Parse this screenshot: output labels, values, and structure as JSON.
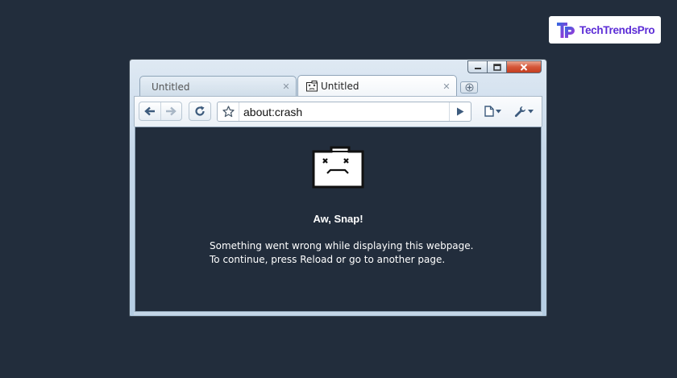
{
  "watermark": {
    "brand_text": "TechTrendsPro",
    "brand_color": "#5b2bd6"
  },
  "window": {
    "caption_buttons": {
      "minimize_icon": "minimize-icon",
      "maximize_icon": "maximize-icon",
      "close_icon": "close-icon",
      "close_color": "#c33d1f"
    },
    "tabs": [
      {
        "label": "Untitled",
        "active": false
      },
      {
        "label": "Untitled",
        "active": true,
        "favicon": "sad-tab-icon"
      }
    ],
    "new_tab_icon": "plus-icon"
  },
  "toolbar": {
    "back_icon": "arrow-left-icon",
    "forward_icon": "arrow-right-icon",
    "reload_icon": "reload-icon",
    "bookmark_icon": "star-icon",
    "address": "about:crash",
    "go_icon": "play-icon",
    "page_menu_icon": "page-icon",
    "tools_menu_icon": "wrench-icon"
  },
  "content": {
    "background": "#222d3c",
    "icon": "sad-folder-icon",
    "title": "Aw, Snap!",
    "message_line1": "Something went wrong while displaying this webpage.",
    "message_line2": "To continue, press Reload or go to another page."
  }
}
